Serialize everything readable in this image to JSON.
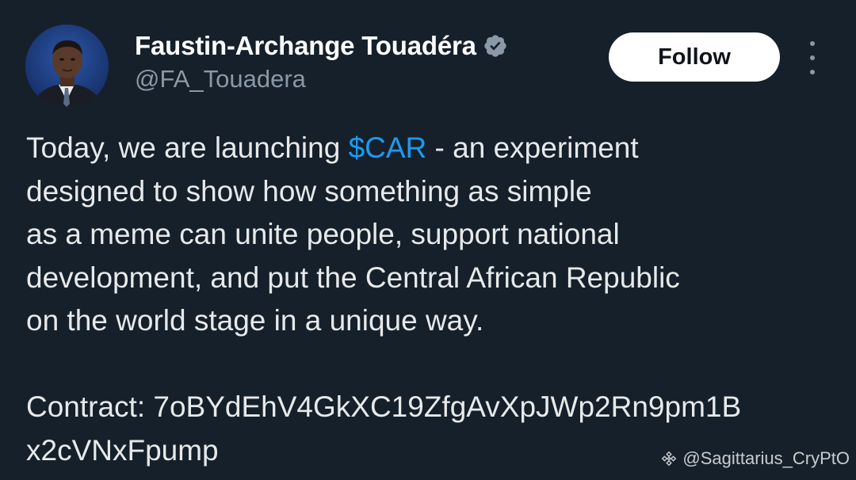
{
  "tweet": {
    "author": {
      "display_name": "Faustin-Archange Touadéra",
      "handle": "@FA_Touadera",
      "verified_icon": "verified-badge-icon"
    },
    "follow_label": "Follow",
    "more_icon": "more-vertical-icon",
    "body": {
      "line1_before": "Today, we are launching ",
      "cashtag": "$CAR",
      "line1_after": " - an experiment",
      "line2": "designed to show how something as simple",
      "line3": "as a meme can unite people, support national",
      "line4": "development, and put the Central African Republic",
      "line5": "on the world stage in a unique way.",
      "line7": "Contract: 7oBYdEhV4GkXC19ZfgAvXpJWp2Rn9pm1B",
      "line8": "x2cVNxFpump"
    }
  },
  "watermark": {
    "icon": "binance-logo-icon",
    "text": "@Sagittarius_CryPtO"
  },
  "colors": {
    "background": "#15202b",
    "text": "#e7e9ea",
    "secondary_text": "#8b98a5",
    "link": "#1d9bf0",
    "button_bg": "#ffffff",
    "button_text": "#0f1419"
  }
}
